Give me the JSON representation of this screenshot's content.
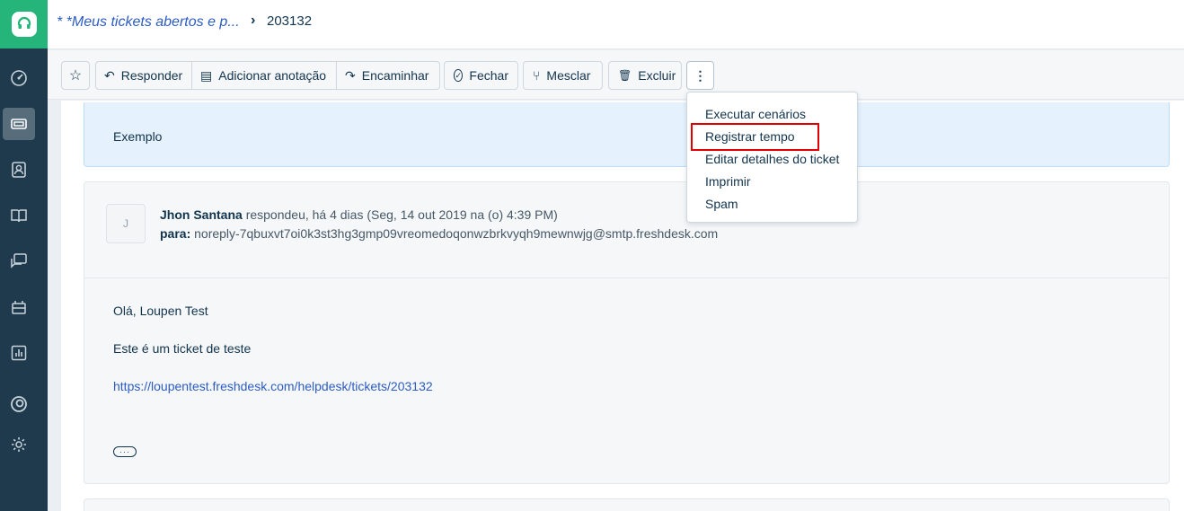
{
  "header": {
    "breadcrumb_link": "* *Meus tickets abertos e p...",
    "breadcrumb_separator": "›",
    "ticket_id": "203132"
  },
  "sidebar": {
    "items": [
      {
        "icon": "dashboard-icon"
      },
      {
        "icon": "tickets-icon",
        "active": true
      },
      {
        "icon": "contacts-icon"
      },
      {
        "icon": "knowledge-base-icon"
      },
      {
        "icon": "forums-icon"
      },
      {
        "icon": "admin-icon"
      },
      {
        "icon": "reports-icon"
      },
      {
        "icon": "freshworks-icon"
      },
      {
        "icon": "settings-icon"
      }
    ]
  },
  "toolbar": {
    "star_icon": "☆",
    "reply_label": "Responder",
    "reply_icon": "↶",
    "add_note_label": "Adicionar anotação",
    "add_note_icon": "▤",
    "forward_label": "Encaminhar",
    "forward_icon": "↷",
    "close_label": "Fechar",
    "close_icon": "✓",
    "merge_label": "Mesclar",
    "merge_icon": "⑂",
    "delete_label": "Excluir",
    "delete_icon": "🗑",
    "more_icon": "⋮"
  },
  "note": {
    "text": "Exemplo"
  },
  "message": {
    "avatar_initial": "J",
    "author": "Jhon Santana",
    "action": "respondeu, há 4 dias (Seg, 14 out 2019 na (o) 4:39 PM)",
    "to_label": "para:",
    "to_address": "noreply-7qbuxvt7oi0k3st3hg3gmp09vreomedoqonwzbrkvyqh9mewnwjg@smtp.freshdesk.com",
    "greeting": "Olá, Loupen Test",
    "body": "Este é um ticket de teste",
    "link": "https://loupentest.freshdesk.com/helpdesk/tickets/203132",
    "more": "···"
  },
  "dropdown": {
    "items": [
      "Executar cenários",
      "Registrar tempo",
      "Editar detalhes do ticket",
      "Imprimir",
      "Spam"
    ],
    "highlighted": "Registrar tempo"
  },
  "colors": {
    "sidebar": "#1f3a4c",
    "brand_green": "#25b47a",
    "link_blue": "#2c5cc5",
    "highlight_red": "#e00000"
  }
}
